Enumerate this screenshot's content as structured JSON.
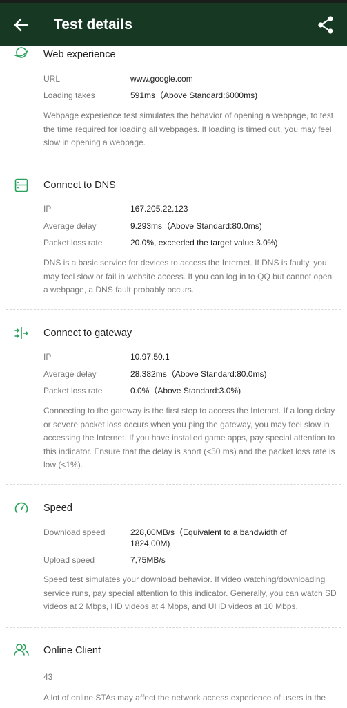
{
  "header": {
    "title": "Test details",
    "back_icon": "arrow-left-icon",
    "share_icon": "share-icon"
  },
  "colors": {
    "header_bg": "#173822",
    "accent": "#2aa15a"
  },
  "web": {
    "title": "Web experience",
    "url_label": "URL",
    "url_value": "www.google.com",
    "loading_label": "Loading takes",
    "loading_value": "591ms（Above Standard:6000ms)",
    "desc": "Webpage experience test simulates the behavior of opening a webpage, to test the time required for loading all webpages. If loading is timed out, you may feel slow in opening a webpage."
  },
  "dns": {
    "title": "Connect to DNS",
    "ip_label": "IP",
    "ip_value": "167.205.22.123",
    "delay_label": "Average delay",
    "delay_value": "9.293ms（Above Standard:80.0ms)",
    "loss_label": "Packet loss rate",
    "loss_value": "20.0%, exceeded the target value.3.0%)",
    "desc": "DNS is a basic service for devices to access the Internet. If DNS is faulty, you may feel slow or fail in website access. If you can log in to QQ but cannot open a webpage, a DNS fault probably occurs."
  },
  "gateway": {
    "title": "Connect to gateway",
    "ip_label": "IP",
    "ip_value": "10.97.50.1",
    "delay_label": "Average delay",
    "delay_value": "28.382ms（Above Standard:80.0ms)",
    "loss_label": "Packet loss rate",
    "loss_value": "0.0%（Above Standard:3.0%)",
    "desc": "Connecting to the gateway is the first step to access the Internet. If a long delay or severe packet loss occurs when you ping the gateway, you may feel slow in accessing the Internet. If you have installed game apps, pay special attention to this indicator. Ensure that the delay is short (<50 ms) and the packet loss rate is low (<1%)."
  },
  "speed": {
    "title": "Speed",
    "download_label": "Download speed",
    "download_value": "228,00MB/s（Equivalent to a bandwidth of 1824,00M)",
    "upload_label": "Upload speed",
    "upload_value": "7,75MB/s",
    "desc": "Speed test simulates your download behavior. If video watching/downloading service runs, pay special attention to this indicator. Generally, you can watch SD videos at 2 Mbps, HD videos at 4 Mbps, and UHD videos at 10 Mbps."
  },
  "clients": {
    "title": "Online Client",
    "count": "43",
    "desc": "A lot of online STAs may affect the network access experience of users in the"
  }
}
